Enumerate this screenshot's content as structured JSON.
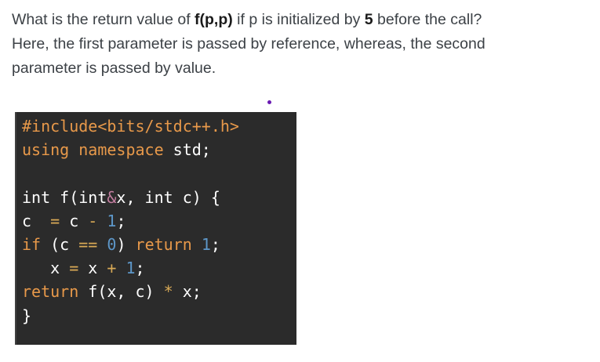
{
  "question": {
    "line1_pre": "What is the return value of ",
    "line1_func": "f(p,p)",
    "line1_mid": " if p is initialized by ",
    "line1_num": "5",
    "line1_post": " before the call?",
    "line2": "Here, the first parameter is passed by reference, whereas, the second",
    "line3": "parameter is passed by value."
  },
  "code": {
    "l1": {
      "include": "#include<bits/stdc++.h>"
    },
    "l2": {
      "using": "using",
      "namespace": "namespace",
      "std": " std;"
    },
    "l3": {
      "blank": ""
    },
    "l4": {
      "t1": "int f(int",
      "amp": "&",
      "t2": "x, int c) {"
    },
    "l5": {
      "c": "c  ",
      "eq": "=",
      "c2": " c ",
      "minus": "-",
      "sp": " ",
      "one": "1",
      "semi": ";"
    },
    "l6": {
      "if": "if",
      "p1": " (c ",
      "eqeq": "==",
      "sp": " ",
      "zero": "0",
      "p2": ") ",
      "ret": "return",
      "sp2": " ",
      "one": "1",
      "semi": ";"
    },
    "l7": {
      "x": "   x ",
      "eq": "=",
      "x2": " x ",
      "plus": "+",
      "sp": " ",
      "one": "1",
      "semi": ";"
    },
    "l8": {
      "ret": "return",
      "t1": " f(x, c) ",
      "star": "*",
      "t2": " x;"
    },
    "l9": {
      "brace": "}"
    }
  },
  "colors": {
    "code_bg": "#2b2b2b",
    "keyword": "#e8994a",
    "number": "#5d97c9",
    "text": "#ffffff",
    "question_text": "#3c4146",
    "dot": "#6a1bb2"
  }
}
